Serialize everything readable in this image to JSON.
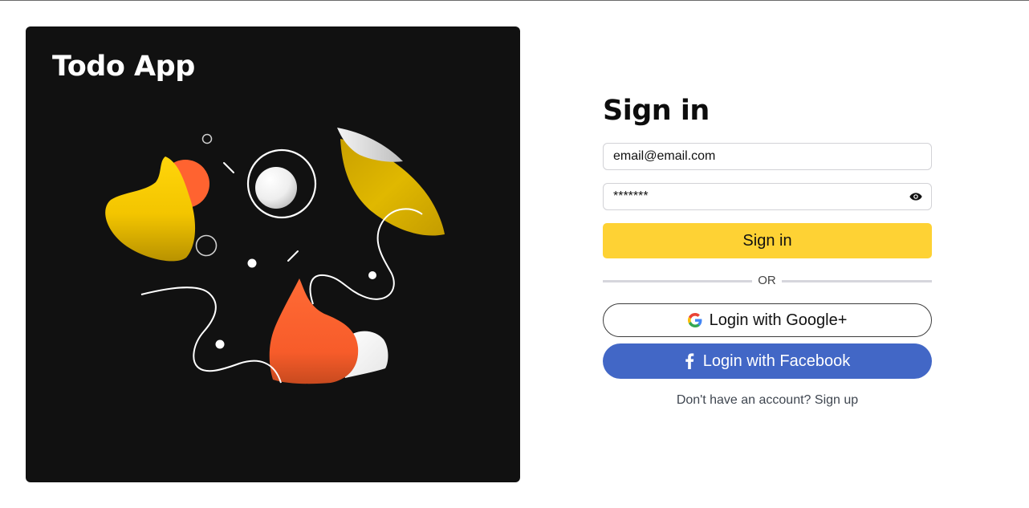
{
  "hero": {
    "title": "Todo App",
    "background": "#111111"
  },
  "form": {
    "title": "Sign in",
    "email_value": "email@email.com",
    "password_value": "*******",
    "password_toggle_icon": "eye-icon",
    "signin_label": "Sign in",
    "divider_text": "OR",
    "google_label": "Login with Google+",
    "google_icon": "google-icon",
    "facebook_label": "Login with Facebook",
    "facebook_icon": "facebook-icon",
    "signup_text": "Don't have an account? Sign up"
  },
  "colors": {
    "accent_yellow": "#fed234",
    "facebook_blue": "#4267c6",
    "shape_orange": "#ff6330",
    "shape_yellow": "#ffd20a"
  }
}
